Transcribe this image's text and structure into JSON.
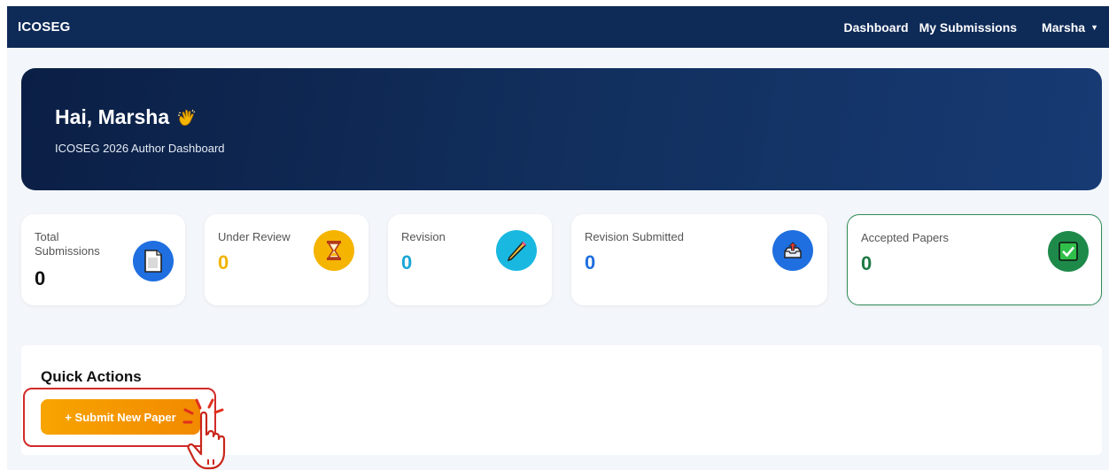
{
  "navbar": {
    "brand": "ICOSEG",
    "links": [
      "Dashboard",
      "My Submissions"
    ],
    "user": "Marsha"
  },
  "hero": {
    "greeting": "Hai, Marsha",
    "subtitle": "ICOSEG 2026 Author Dashboard"
  },
  "stats": [
    {
      "label_line1": "Total",
      "label_line2": "Submissions",
      "value": "0",
      "color": "#111111",
      "icon": "document-icon",
      "icon_bg": "#1f6fe0"
    },
    {
      "label_line1": "Under Review",
      "label_line2": "",
      "value": "0",
      "color": "#f0b400",
      "icon": "hourglass-icon",
      "icon_bg": "#f5b400"
    },
    {
      "label_line1": "Revision",
      "label_line2": "",
      "value": "0",
      "color": "#1aa6d6",
      "icon": "pencil-icon",
      "icon_bg": "#19b8e0"
    },
    {
      "label_line1": "Revision Submitted",
      "label_line2": "",
      "value": "0",
      "color": "#1f6fe0",
      "icon": "upload-tray-icon",
      "icon_bg": "#1f6fe0"
    },
    {
      "label_line1": "Accepted Papers",
      "label_line2": "",
      "value": "0",
      "color": "#1e7a45",
      "icon": "checkmark-icon",
      "icon_bg": "#1e8a4a"
    }
  ],
  "quick_actions": {
    "title": "Quick Actions",
    "submit_label": "+ Submit New Paper"
  }
}
